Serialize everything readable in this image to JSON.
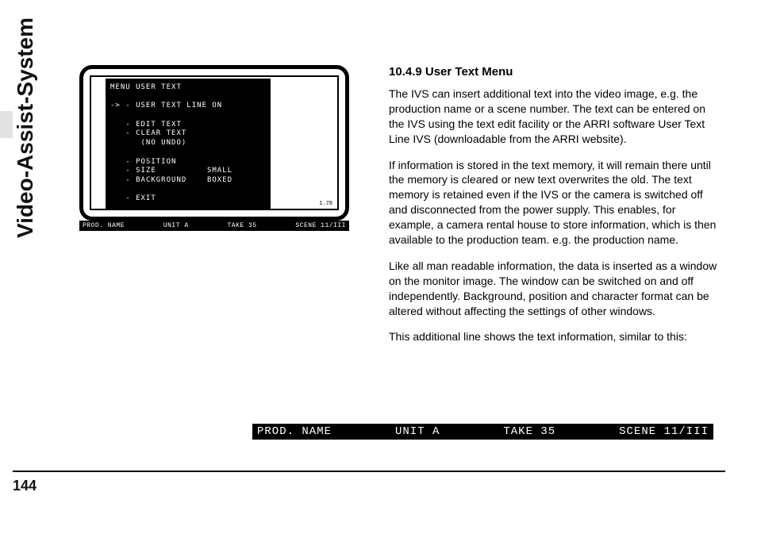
{
  "sidebar": {
    "title": "Video-Assist-System"
  },
  "page": {
    "number": "144"
  },
  "section": {
    "title": "10.4.9 User Text Menu",
    "paragraphs": [
      "The IVS can insert additional text into the video image, e.g. the production name or a scene number. The text can be entered on the IVS using the text edit facility or the ARRI software User Text Line IVS (downloadable from the ARRI website).",
      "If information is stored in the text memory, it will remain there until the memory is cleared or new text overwrites the old. The text memory is retained even if the IVS or the camera is switched off and disconnected from the power supply. This enables, for example, a camera rental house to store information, which is then available to the production team. e.g. the production name.",
      "Like all man readable information, the data is inserted as a window on the monitor image. The window can be switched on and off independently. Background, position and character format can be altered without affecting the settings of other windows.",
      "This additional line shows the text information, similar to this:"
    ]
  },
  "statusbar": {
    "prod": "PROD. NAME",
    "unit": "UNIT A",
    "take": "TAKE 35",
    "scene": "SCENE 11/III"
  },
  "monitor": {
    "menu": "MENU USER TEXT\n\n-> - USER TEXT LINE ON\n\n   - EDIT TEXT\n   - CLEAR TEXT\n      (NO UNDO)\n\n   - POSITION\n   - SIZE          SMALL\n   - BACKGROUND    BOXED\n\n   - EXIT",
    "corner": "1.78",
    "status": {
      "prod": "PROD. NAME",
      "unit": "UNIT A",
      "take": "TAKE 35",
      "scene": "SCENE 11/III"
    }
  }
}
